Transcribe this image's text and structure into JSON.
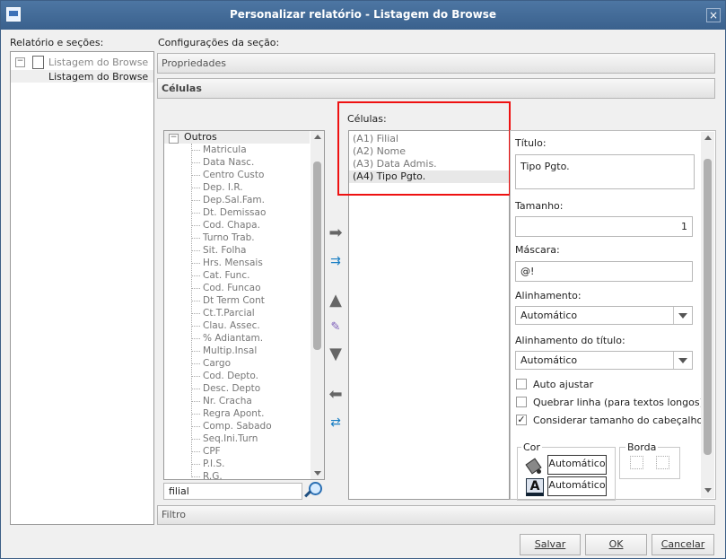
{
  "window": {
    "title": "Personalizar relatório - Listagem do Browse",
    "close": "×"
  },
  "left": {
    "label": "Relatório e seções:",
    "tree": [
      {
        "expander": "−",
        "label": "Listagem do Browse"
      },
      {
        "label": "Listagem do Browse"
      }
    ]
  },
  "section": {
    "label": "Configurações da seção:",
    "propriedades": "Propriedades",
    "celulas_tab": "Células",
    "filtro": "Filtro"
  },
  "fields": {
    "group_expander": "−",
    "group": "Outros",
    "items": [
      "Matricula",
      "Data Nasc.",
      "Centro Custo",
      "Dep. I.R.",
      "Dep.Sal.Fam.",
      "Dt. Demissao",
      "Cod. Chapa.",
      "Turno Trab.",
      "Sit. Folha",
      "Hrs. Mensais",
      "Cat. Func.",
      "Cod. Funcao",
      "Dt Term Cont",
      "Ct.T.Parcial",
      "Clau. Assec.",
      "% Adiantam.",
      "Multip.Insal",
      "Cargo",
      "Cod. Depto.",
      "Desc. Depto",
      "Nr. Cracha",
      "Regra Apont.",
      "Comp. Sabado",
      "Seq.Ini.Turn",
      "CPF",
      "P.I.S.",
      "R.G."
    ],
    "search_value": "filial"
  },
  "cells": {
    "label": "Células:",
    "items": [
      "(A1) Filial",
      "(A2) Nome",
      "(A3) Data Admis.",
      "(A4) Tipo Pgto."
    ],
    "selected_index": 3
  },
  "props": {
    "titulo_label": "Título:",
    "titulo_value": "Tipo Pgto.",
    "tamanho_label": "Tamanho:",
    "tamanho_value": "1",
    "mascara_label": "Máscara:",
    "mascara_value": "@!",
    "alinhamento_label": "Alinhamento:",
    "alinhamento_value": "Automático",
    "alinhamento_titulo_label": "Alinhamento do título:",
    "alinhamento_titulo_value": "Automático",
    "auto_ajustar": {
      "label": "Auto ajustar",
      "checked": false
    },
    "quebrar_linha": {
      "label": "Quebrar linha (para textos longos)",
      "checked": false
    },
    "considerar": {
      "label": "Considerar tamanho do cabeçalho",
      "checked": true,
      "mark": "✓"
    },
    "cor_label": "Cor",
    "cor_fundo": "Automático",
    "cor_fonte": "Automático",
    "cor_fonte_icon": "A",
    "borda_label": "Borda"
  },
  "buttons": {
    "salvar": "Salvar",
    "ok": "OK",
    "cancelar": "Cancelar"
  },
  "colors": {
    "titlebar": "#4d76a3",
    "highlight": "#e11111",
    "selected_row": "#e8e8e8"
  }
}
